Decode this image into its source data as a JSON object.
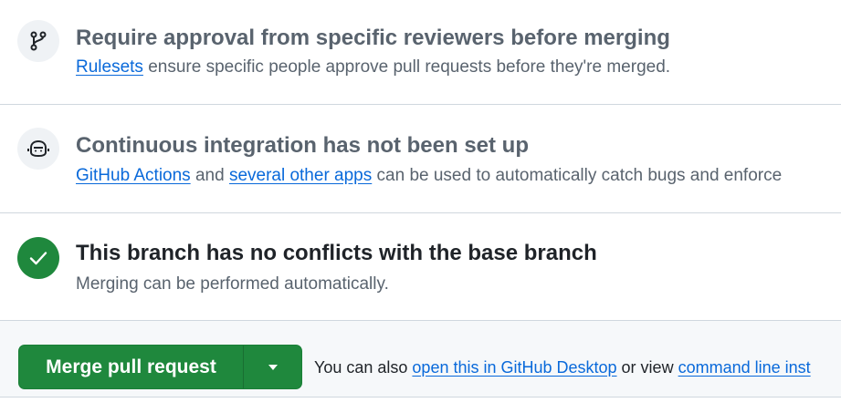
{
  "reviewers": {
    "icon": "git-branch-icon",
    "title": "Require approval from specific reviewers before merging",
    "link": "Rulesets",
    "text": " ensure specific people approve pull requests before they're merged."
  },
  "ci": {
    "icon": "robot-icon",
    "title": "Continuous integration has not been set up",
    "link1": "GitHub Actions",
    "mid": " and ",
    "link2": "several other apps",
    "text": " can be used to automatically catch bugs and enforce"
  },
  "conflicts": {
    "icon": "check-icon",
    "title": "This branch has no conflicts with the base branch",
    "text": "Merging can be performed automatically."
  },
  "merge": {
    "button_label": "Merge pull request",
    "dropdown_icon": "triangle-down-icon",
    "note_prefix": "You can also ",
    "link1": "open this in GitHub Desktop",
    "note_mid": " or view ",
    "link2": "command line inst"
  },
  "colors": {
    "success": "#1f883d",
    "link": "#0969da",
    "muted": "#59636e"
  }
}
